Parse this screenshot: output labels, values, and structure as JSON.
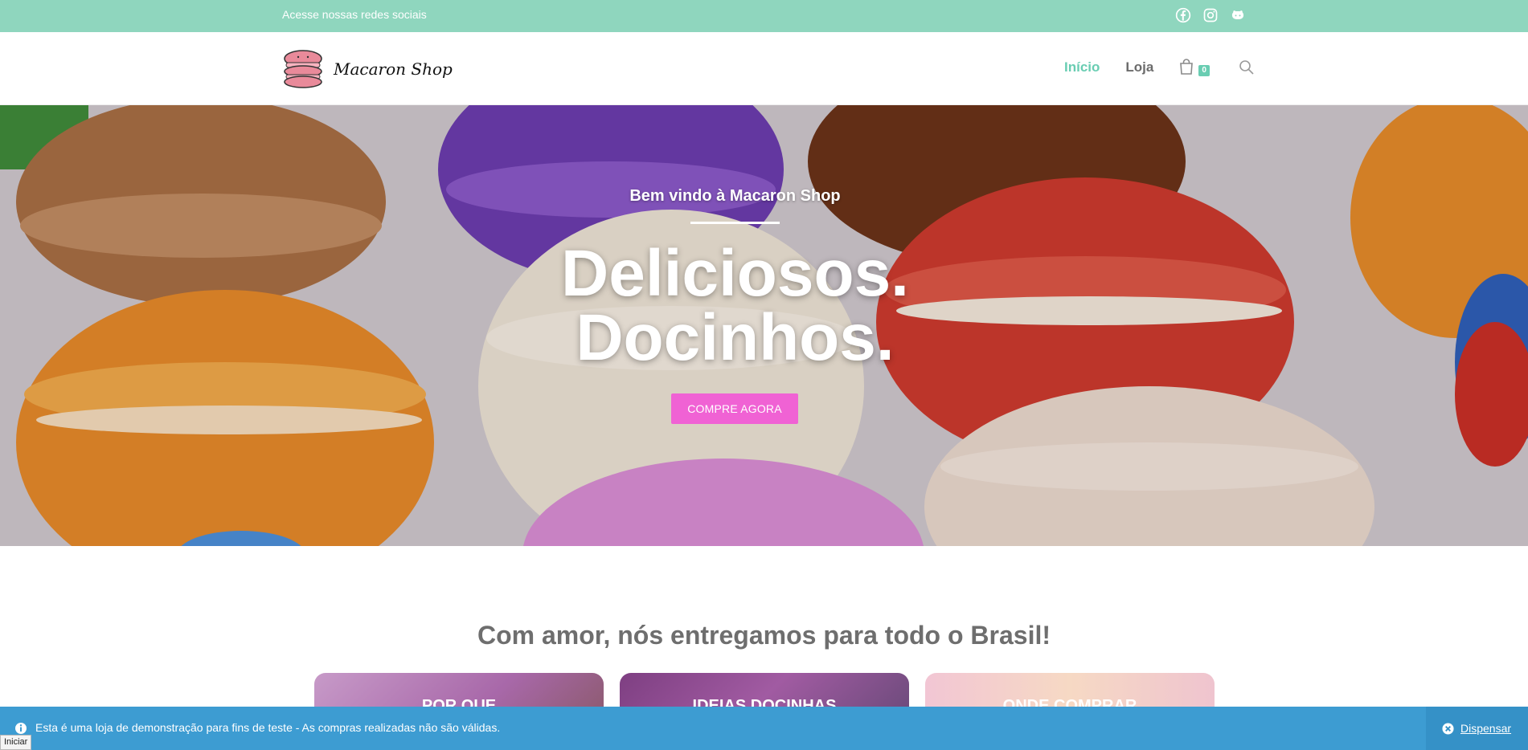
{
  "topbar": {
    "social_text": "Acesse nossas redes sociais",
    "icons": [
      "facebook-icon",
      "instagram-icon",
      "github-icon"
    ],
    "background": "#8fd6be"
  },
  "header": {
    "logo_text": "Macaron Shop",
    "nav": [
      {
        "label": "Início",
        "active": true
      },
      {
        "label": "Loja",
        "active": false
      }
    ],
    "cart_count": "0",
    "accent": "#69cdb2"
  },
  "hero": {
    "subtitle": "Bem vindo à Macaron Shop",
    "title_line1": "Deliciosos.",
    "title_line2": "Docinhos.",
    "cta_label": "COMPRE AGORA",
    "cta_color": "#f062d4"
  },
  "section": {
    "title": "Com amor, nós entregamos para todo o Brasil!",
    "cards": [
      {
        "label": "POR QUE"
      },
      {
        "label": "IDEIAS DOCINHAS"
      },
      {
        "label": "ONDE COMPRAR"
      }
    ]
  },
  "notice": {
    "text": "Esta é uma loja de demonstração para fins de teste - As compras realizadas não são válidas.",
    "dismiss_label": "Dispensar",
    "background": "#3d9cd2"
  },
  "status": {
    "tooltip": "Iniciar"
  }
}
